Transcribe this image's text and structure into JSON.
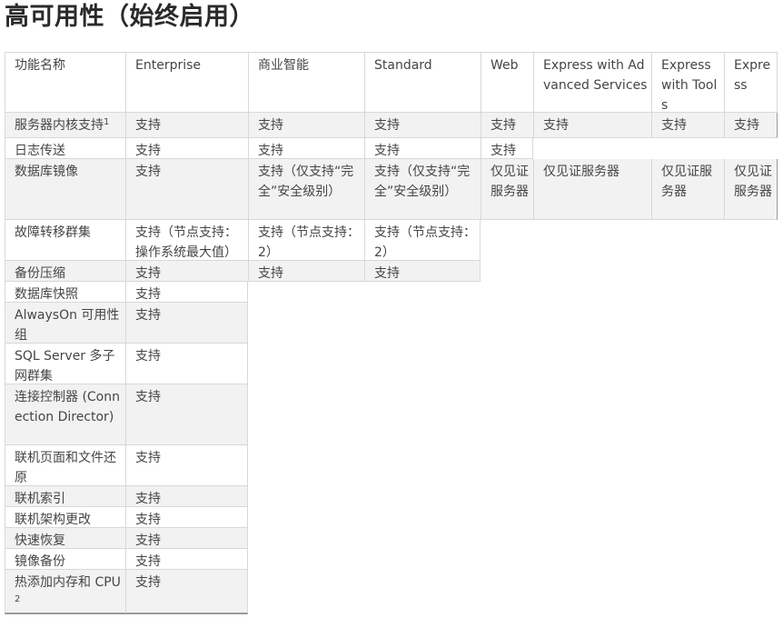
{
  "title": "高可用性（始终启用）",
  "table": {
    "headers": [
      "功能名称",
      "Enterprise",
      "商业智能",
      "Standard",
      "Web",
      "Express with Advanced Services",
      "Express with Tools",
      "Express"
    ],
    "rows": [
      {
        "feature": "服务器内核支持",
        "footnote": "1",
        "cells": [
          "支持",
          "支持",
          "支持",
          "支持",
          "支持",
          "支持",
          "支持"
        ]
      },
      {
        "feature": "日志传送",
        "cells": [
          "支持",
          "支持",
          "支持",
          "支持"
        ]
      },
      {
        "feature": "数据库镜像",
        "cells": [
          "支持",
          "支持（仅支持“完全”安全级别）",
          "支持（仅支持“完全”安全级别）",
          "仅见证服务器",
          "仅见证服务器",
          "仅见证服务器",
          "仅见证服务器"
        ]
      },
      {
        "feature": "故障转移群集",
        "cells": [
          "支持（节点支持：操作系统最大值）",
          "支持（节点支持：2）",
          "支持（节点支持：2）"
        ]
      },
      {
        "feature": "备份压缩",
        "cells": [
          "支持",
          "支持",
          "支持"
        ]
      },
      {
        "feature": "数据库快照",
        "cells": [
          "支持"
        ]
      },
      {
        "feature": "AlwaysOn 可用性组",
        "cells": [
          "支持"
        ]
      },
      {
        "feature": "SQL Server 多子网群集",
        "cells": [
          "支持"
        ]
      },
      {
        "feature": "连接控制器 (Connection Director)",
        "cells": [
          "支持"
        ]
      },
      {
        "feature": "联机页面和文件还原",
        "cells": [
          "支持"
        ]
      },
      {
        "feature": "联机索引",
        "cells": [
          "支持"
        ]
      },
      {
        "feature": "联机架构更改",
        "cells": [
          "支持"
        ]
      },
      {
        "feature": "快速恢复",
        "cells": [
          "支持"
        ]
      },
      {
        "feature": "镜像备份",
        "cells": [
          "支持"
        ]
      },
      {
        "feature": "热添加内存和 CPU",
        "footnote": "2",
        "cells": [
          "支持"
        ]
      }
    ]
  }
}
